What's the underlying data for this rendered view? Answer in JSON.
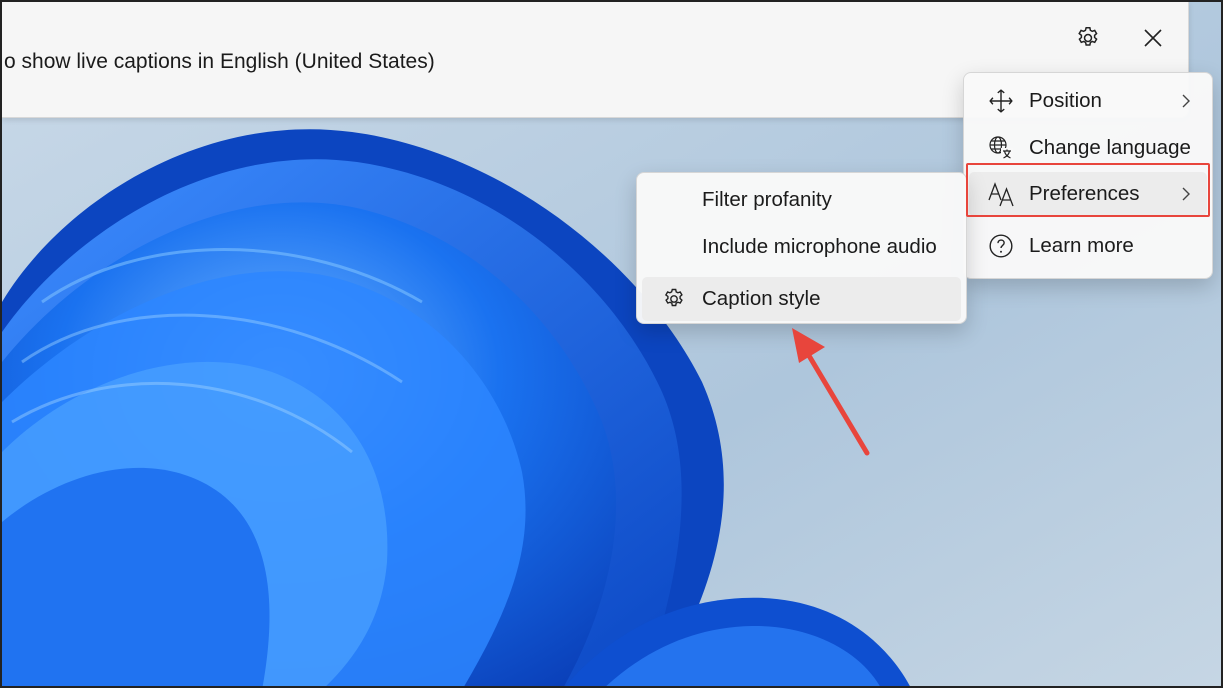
{
  "caption_bar": {
    "text": "o show live captions in English (United States)",
    "settings_icon": "gear-icon",
    "close_icon": "close-icon"
  },
  "main_menu": {
    "items": [
      {
        "label": "Position",
        "icon": "move-arrows-icon",
        "has_submenu": true
      },
      {
        "label": "Change language",
        "icon": "language-icon",
        "has_submenu": false
      },
      {
        "label": "Preferences",
        "icon": "font-size-icon",
        "has_submenu": true,
        "highlighted": true
      },
      {
        "label": "Learn more",
        "icon": "help-circle-icon",
        "has_submenu": false
      }
    ]
  },
  "sub_menu": {
    "items": [
      {
        "label": "Filter profanity",
        "icon": ""
      },
      {
        "label": "Include microphone audio",
        "icon": ""
      },
      {
        "label": "Caption style",
        "icon": "gear-icon",
        "hovered": true
      }
    ]
  },
  "colors": {
    "annotation_red": "#e8453c",
    "menu_bg": "#f9f9f9",
    "wallpaper_blue": "#1565e8"
  }
}
